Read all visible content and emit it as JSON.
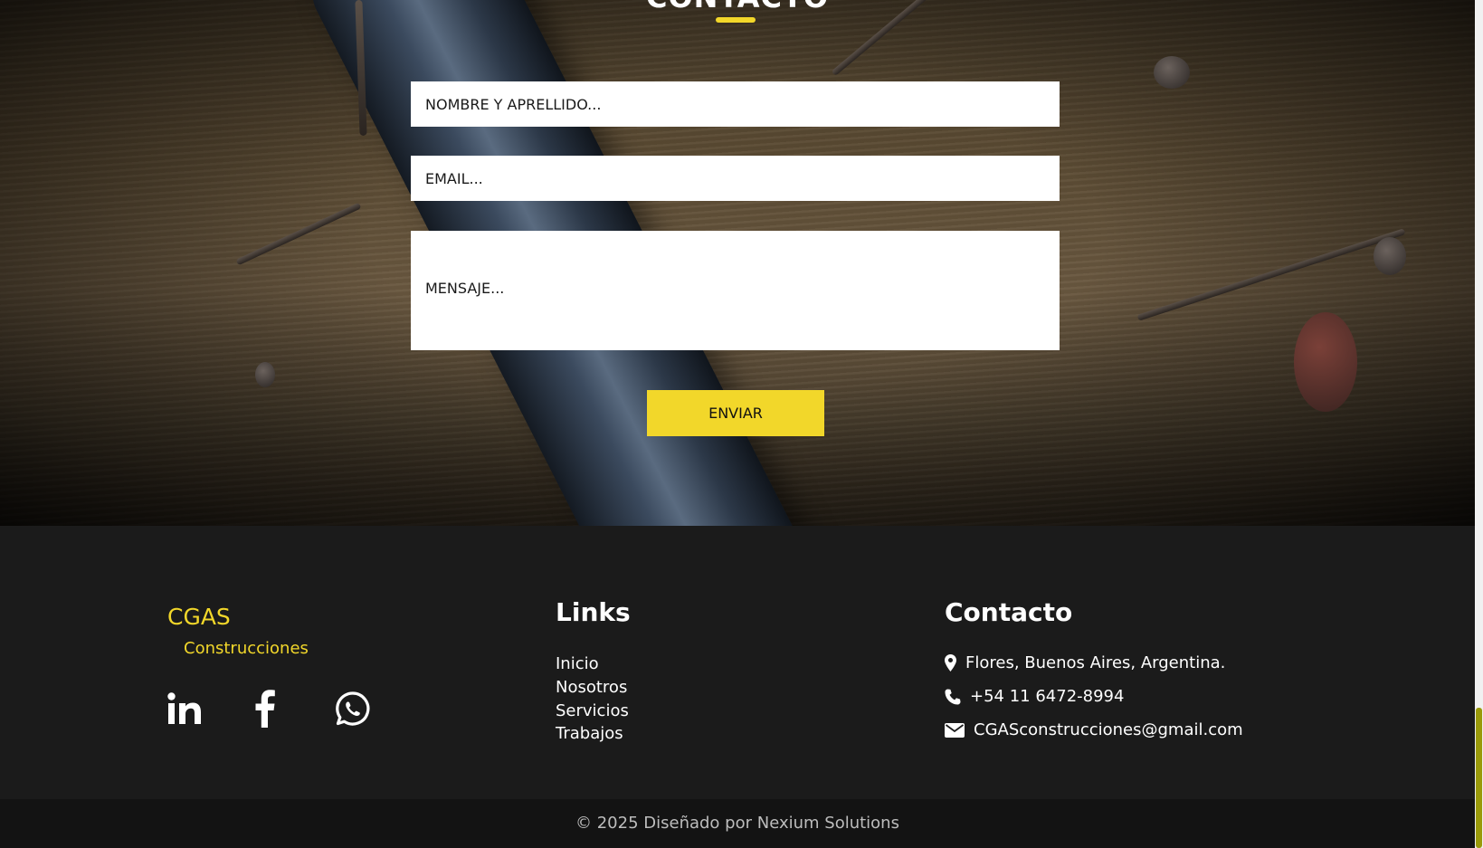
{
  "contact_section": {
    "title": "CONTACTO",
    "name_placeholder": "NOMBRE Y APRELLIDO...",
    "email_placeholder": "EMAIL...",
    "message_placeholder": "MENSAJE...",
    "send_label": "ENVIAR",
    "accent_color": "#f2d72a"
  },
  "footer": {
    "brand_name": "CGAS",
    "brand_sub": "Construcciones",
    "social_icons": [
      "linkedin-icon",
      "facebook-icon",
      "whatsapp-icon"
    ],
    "links": {
      "title": "Links",
      "items": [
        "Inicio",
        "Nosotros",
        "Servicios",
        "Trabajos"
      ]
    },
    "contact": {
      "title": "Contacto",
      "address": "Flores, Buenos Aires, Argentina.",
      "phone": "+54 11 6472-8994",
      "email": "CGASconstrucciones@gmail.com",
      "icons": [
        "location-pin-icon",
        "phone-icon",
        "envelope-icon"
      ]
    },
    "copyright": "© 2025 Diseñado por Nexium Solutions"
  }
}
